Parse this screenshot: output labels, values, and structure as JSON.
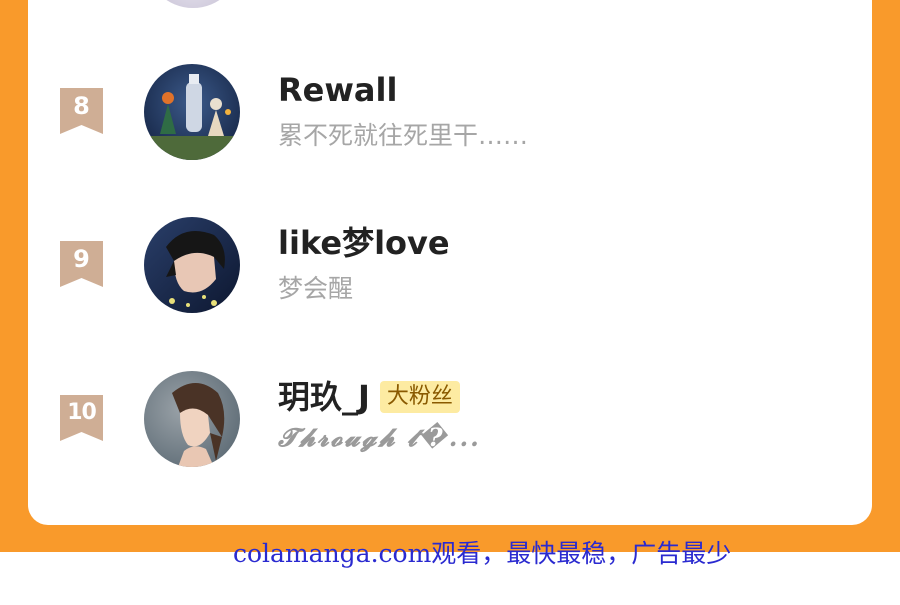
{
  "colors": {
    "background_orange": "#f99a2b",
    "card": "#ffffff",
    "rank_badge": "#cfae95",
    "name_text": "#222222",
    "signature_text": "#a6a6a6",
    "fan_badge_bg": "#fdeba2",
    "fan_badge_text": "#8a5a00",
    "watermark": "#2a2ad0"
  },
  "ranking": [
    {
      "rank": "8",
      "name": "Rewall",
      "signature": "累不死就往死里干……",
      "badge": "",
      "avatar_icon": "avatar-sky-game-characters-icon"
    },
    {
      "rank": "9",
      "name": "like梦love",
      "signature": "梦会醒",
      "badge": "",
      "avatar_icon": "avatar-anime-boy-icon"
    },
    {
      "rank": "10",
      "name": "玥玖_J",
      "signature": "𝓣𝓱𝓻𝓸𝓾𝓰𝓱 𝓽�...",
      "badge": "大粉丝",
      "avatar_icon": "avatar-girl-portrait-icon"
    }
  ],
  "watermark": "colamanga.com观看，最快最稳，广告最少"
}
